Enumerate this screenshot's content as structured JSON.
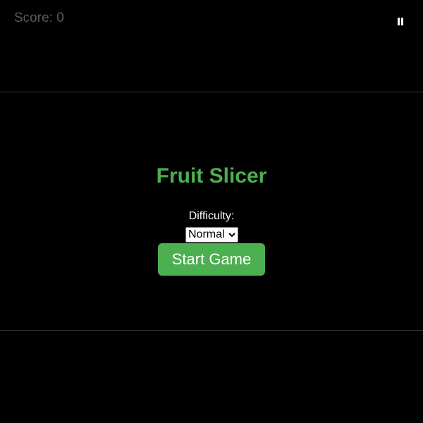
{
  "hud": {
    "score_text": "Score: 0",
    "pause_icon": "pause-icon"
  },
  "menu": {
    "title": "Fruit Slicer",
    "difficulty_label": "Difficulty:",
    "difficulty_selected": "Normal",
    "start_label": "Start Game"
  },
  "colors": {
    "background": "#000000",
    "accent": "#4caf50",
    "score_text": "#5a5a5a",
    "divider": "#3a3a3a"
  }
}
